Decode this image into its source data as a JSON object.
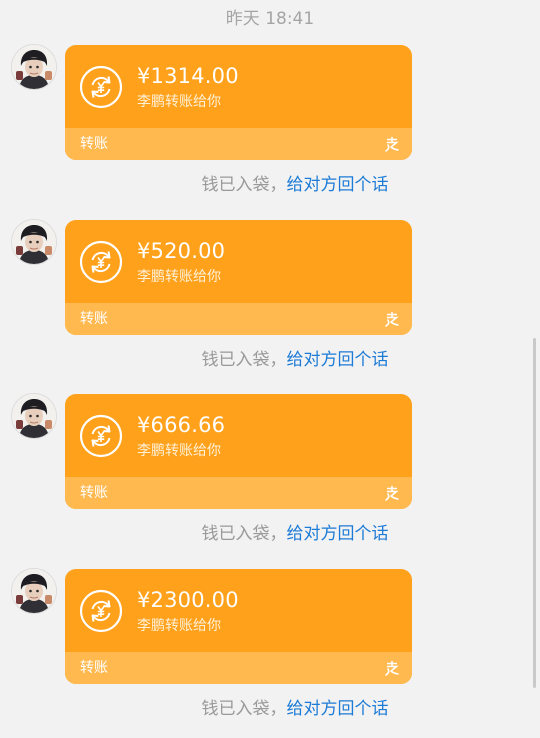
{
  "timestamp": "昨天 18:41",
  "messages": [
    {
      "amount": "¥1314.00",
      "description": "李鹏转账给你",
      "type_label": "转账"
    },
    {
      "amount": "¥520.00",
      "description": "李鹏转账给你",
      "type_label": "转账"
    },
    {
      "amount": "¥666.66",
      "description": "李鹏转账给你",
      "type_label": "转账"
    },
    {
      "amount": "¥2300.00",
      "description": "李鹏转账给你",
      "type_label": "转账"
    }
  ],
  "notice": {
    "text": "钱已入袋，",
    "link": "给对方回个话"
  },
  "icons": {
    "transfer": "transfer-exchange-icon",
    "payment": "alipay-icon"
  },
  "colors": {
    "card": "#ffa11a",
    "card_footer": "#ffb94f",
    "link": "#1c7bd6",
    "muted": "#999999"
  }
}
